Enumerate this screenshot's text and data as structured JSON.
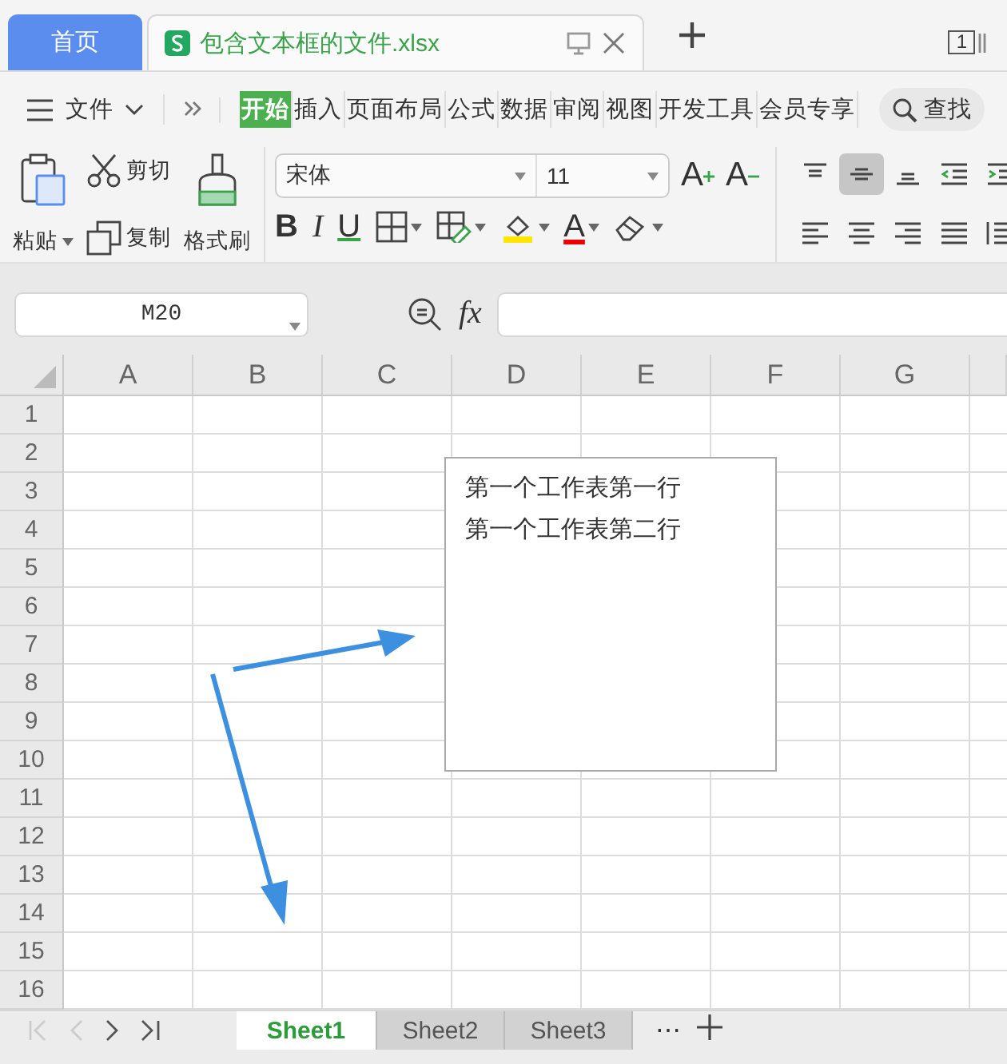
{
  "doc_tabs": [
    {
      "label": "首页",
      "kind": "home",
      "selected": false
    },
    {
      "label": "包含文本框的文件.xlsx",
      "kind": "file",
      "selected": true
    }
  ],
  "window_count": "1",
  "menu": {
    "file_label": "文件",
    "items": [
      {
        "label": "开始",
        "selected": true
      },
      {
        "label": "插入",
        "selected": false
      },
      {
        "label": "页面布局",
        "selected": false
      },
      {
        "label": "公式",
        "selected": false
      },
      {
        "label": "数据",
        "selected": false
      },
      {
        "label": "审阅",
        "selected": false
      },
      {
        "label": "视图",
        "selected": false
      },
      {
        "label": "开发工具",
        "selected": false
      },
      {
        "label": "会员专享",
        "selected": false
      }
    ],
    "search_label": "查找"
  },
  "clipboard": {
    "paste": "粘贴",
    "cut": "剪切",
    "copy": "复制",
    "format_painter": "格式刷"
  },
  "font": {
    "name": "宋体",
    "size": "11"
  },
  "font_size_buttons": [
    {
      "kind": "grow",
      "glyph": "A"
    },
    {
      "kind": "shrink",
      "glyph": "A"
    }
  ],
  "font_buttons": [
    {
      "kind": "bold",
      "glyph": "B"
    },
    {
      "kind": "italic",
      "glyph": "I"
    },
    {
      "kind": "underline",
      "glyph": "U"
    },
    {
      "kind": "border"
    },
    {
      "kind": "cell_style"
    },
    {
      "kind": "fill"
    },
    {
      "kind": "font_color",
      "glyph": "A"
    },
    {
      "kind": "eraser"
    }
  ],
  "align_buttons": [
    {
      "kind": "top",
      "selected": false
    },
    {
      "kind": "middle",
      "selected": true
    },
    {
      "kind": "bottom",
      "selected": false
    },
    {
      "kind": "outdent",
      "selected": false
    },
    {
      "kind": "indent",
      "selected": false
    },
    {
      "kind": "left",
      "selected": false
    },
    {
      "kind": "center",
      "selected": false
    },
    {
      "kind": "right",
      "selected": false
    },
    {
      "kind": "justify",
      "selected": false
    },
    {
      "kind": "distribute",
      "selected": false
    }
  ],
  "formula_bar": {
    "name_box": "M20",
    "fx": "fx"
  },
  "sheet": {
    "columns": [
      "A",
      "B",
      "C",
      "D",
      "E",
      "F",
      "G"
    ],
    "rows": [
      "1",
      "2",
      "3",
      "4",
      "5",
      "6",
      "7",
      "8",
      "9",
      "10",
      "11",
      "12",
      "13",
      "14",
      "15",
      "16"
    ],
    "text_box": [
      "第一个工作表第一行",
      "第一个工作表第二行"
    ]
  },
  "sheet_tabs": [
    {
      "label": "Sheet1",
      "selected": true
    },
    {
      "label": "Sheet2",
      "selected": false
    },
    {
      "label": "Sheet3",
      "selected": false
    }
  ],
  "more_sheets": "⋯"
}
